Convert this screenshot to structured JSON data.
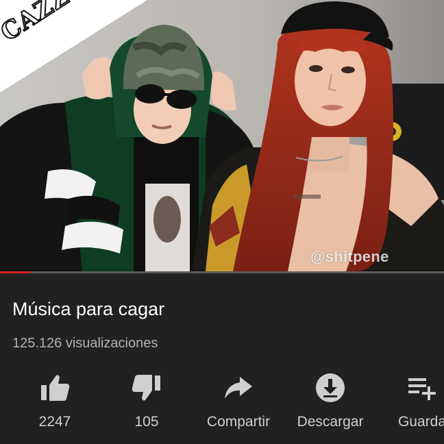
{
  "video": {
    "overlay_logo_text": "CAZZU",
    "watermark": "@shitpene",
    "progress_percent": 7
  },
  "info": {
    "title": "Música para cagar",
    "views": "125.126 visualizaciones"
  },
  "actions": [
    {
      "icon": "thumb-up-icon",
      "label": "2247"
    },
    {
      "icon": "thumb-down-icon",
      "label": "105"
    },
    {
      "icon": "share-icon",
      "label": "Compartir"
    },
    {
      "icon": "download-icon",
      "label": "Descargar"
    },
    {
      "icon": "playlist-add-icon",
      "label": "Guarda"
    }
  ],
  "colors": {
    "background": "#212121",
    "progress": "#d32020",
    "icon": "#cfcfcf",
    "title": "#ffffff",
    "secondary_text": "#b2b2b2"
  }
}
